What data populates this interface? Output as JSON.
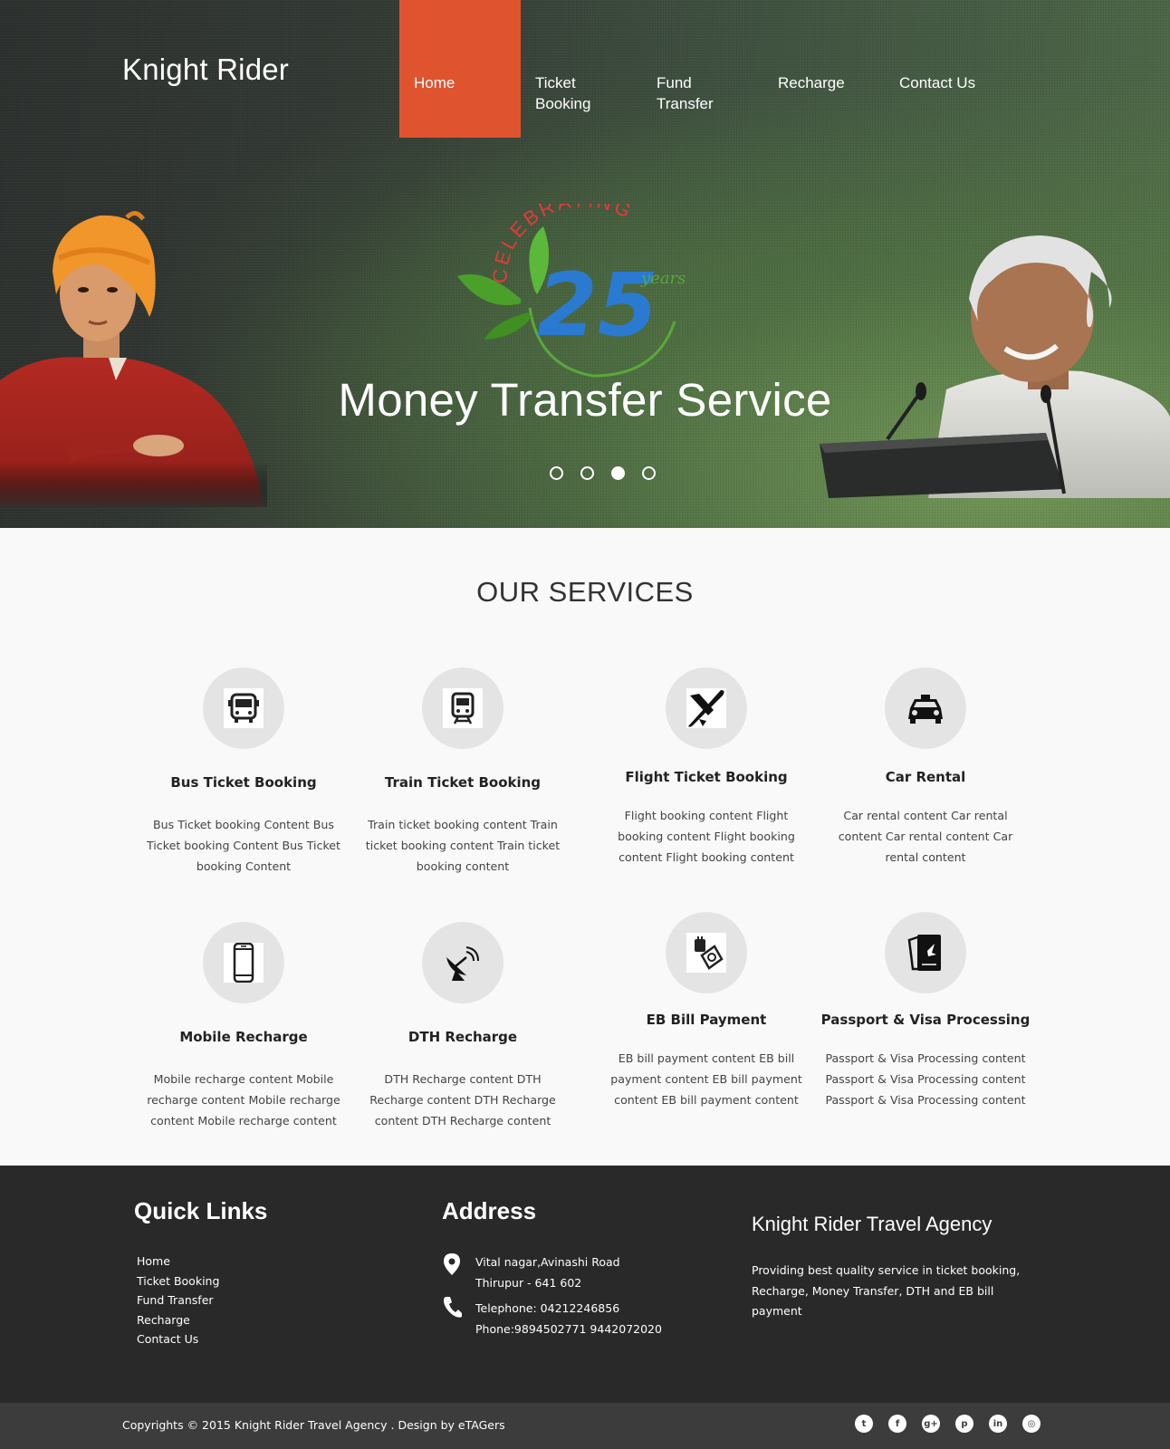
{
  "header": {
    "brand": "Knight Rider",
    "nav": [
      {
        "line1": "Home",
        "line2": ""
      },
      {
        "line1": "Ticket",
        "line2": "Booking"
      },
      {
        "line1": "Fund",
        "line2": "Transfer"
      },
      {
        "line1": "Recharge",
        "line2": ""
      },
      {
        "line1": "Contact Us",
        "line2": ""
      }
    ],
    "active_nav": "Home",
    "accent_color": "#e0532f"
  },
  "hero": {
    "badge_arc_text": "CELEBRATING",
    "badge_number": "25",
    "badge_years": "years",
    "title": "Money Transfer Service",
    "slide_count": 4,
    "active_slide": 3
  },
  "services": {
    "title": "OUR SERVICES",
    "items": [
      {
        "name": "Bus Ticket Booking",
        "icon": "bus-icon",
        "desc": "Bus Ticket booking Content Bus Ticket booking Content Bus Ticket booking Content"
      },
      {
        "name": "Train Ticket Booking",
        "icon": "train-icon",
        "desc": "Train ticket booking content Train ticket booking content Train ticket booking content"
      },
      {
        "name": "Flight Ticket Booking",
        "icon": "airplane-icon",
        "desc": "Flight booking content Flight booking content Flight booking content Flight booking content"
      },
      {
        "name": "Car Rental",
        "icon": "car-icon",
        "desc": "Car rental content Car rental content Car rental content Car rental content"
      },
      {
        "name": "Mobile Recharge",
        "icon": "mobile-phone-icon",
        "desc": "Mobile recharge content Mobile recharge content Mobile recharge content Mobile recharge content"
      },
      {
        "name": "DTH Recharge",
        "icon": "satellite-dish-icon",
        "desc": "DTH Recharge content DTH Recharge content DTH Recharge content DTH Recharge content"
      },
      {
        "name": "EB Bill Payment",
        "icon": "electricity-bill-icon",
        "desc": "EB bill payment content EB bill payment content EB bill payment content EB bill payment content"
      },
      {
        "name": "Passport & Visa Processing",
        "icon": "passport-icon",
        "desc": "Passport & Visa Processing content Passport & Visa Processing content Passport & Visa Processing content"
      }
    ]
  },
  "footer": {
    "quick_links_title": "Quick Links",
    "quick_links": [
      "Home",
      "Ticket Booking",
      "Fund Transfer",
      "Recharge",
      "Contact Us"
    ],
    "address_title": "Address",
    "address_line1": "Vital nagar,Avinashi Road",
    "address_line2": "Thirupur - 641 602",
    "telephone": "Telephone: 04212246856",
    "phone": "Phone:9894502771 9442072020",
    "agency_title": "Knight Rider Travel Agency",
    "agency_desc": "Providing best quality service in ticket booking, Recharge, Money Transfer, DTH and EB bill payment",
    "copyright": "Copyrights © 2015 Knight Rider Travel Agency . Design by eTAGers",
    "socials": [
      {
        "name": "twitter-icon",
        "glyph": "t"
      },
      {
        "name": "facebook-icon",
        "glyph": "f"
      },
      {
        "name": "google-plus-icon",
        "glyph": "g+"
      },
      {
        "name": "pinterest-icon",
        "glyph": "p"
      },
      {
        "name": "linkedin-icon",
        "glyph": "in"
      },
      {
        "name": "dribbble-icon",
        "glyph": "◎"
      }
    ]
  }
}
